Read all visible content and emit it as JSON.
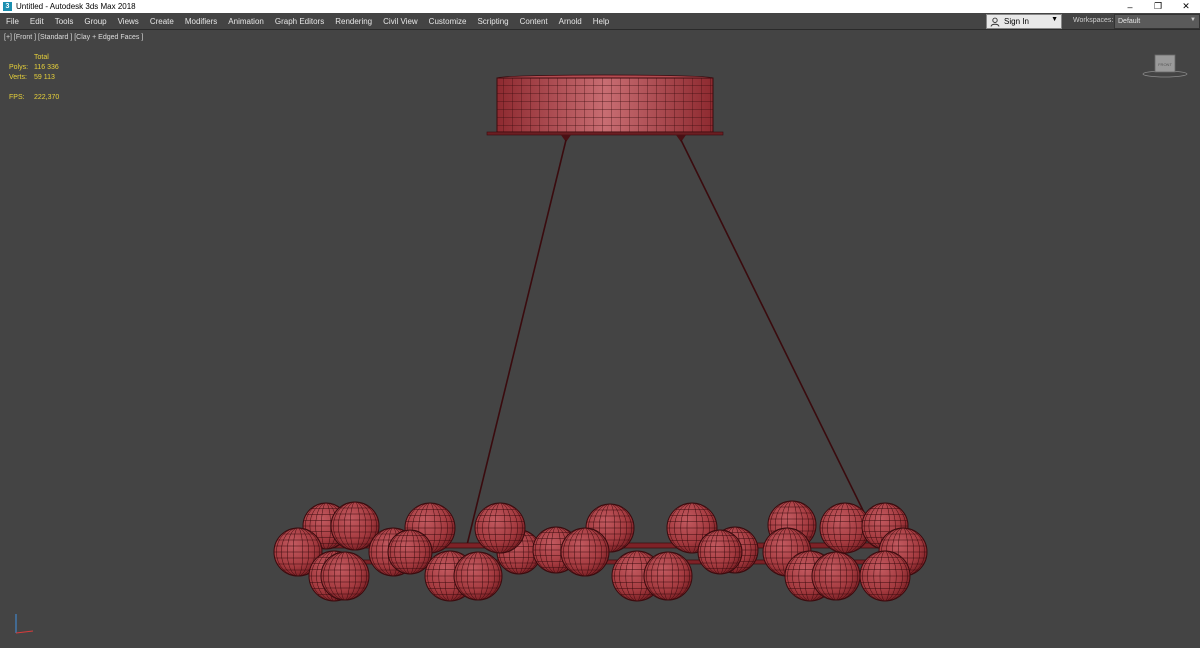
{
  "window": {
    "title": "Untitled - Autodesk 3ds Max 2018",
    "icon": "3ds-max-icon",
    "controls": {
      "minimize": "–",
      "restore": "❐",
      "close": "✕"
    }
  },
  "menu": {
    "items": [
      "File",
      "Edit",
      "Tools",
      "Group",
      "Views",
      "Create",
      "Modifiers",
      "Animation",
      "Graph Editors",
      "Rendering",
      "Civil View",
      "Customize",
      "Scripting",
      "Content",
      "Arnold",
      "Help"
    ],
    "sign_in": "Sign In",
    "workspaces_label": "Workspaces:",
    "workspaces_value": "Default"
  },
  "viewport": {
    "label": "[+] [Front ] [Standard ] [Clay + Edged Faces ]",
    "stats": {
      "header": "Total",
      "polys_label": "Polys:",
      "polys_value": "116 336",
      "verts_label": "Verts:",
      "verts_value": "59 113",
      "fps_label": "FPS:",
      "fps_value": "222,370"
    },
    "viewcube_label": "FRONT",
    "colors": {
      "background": "#444444",
      "object": "#a43a3f",
      "wire": "#3a0b0e",
      "stats_text": "#e8d23a"
    }
  }
}
